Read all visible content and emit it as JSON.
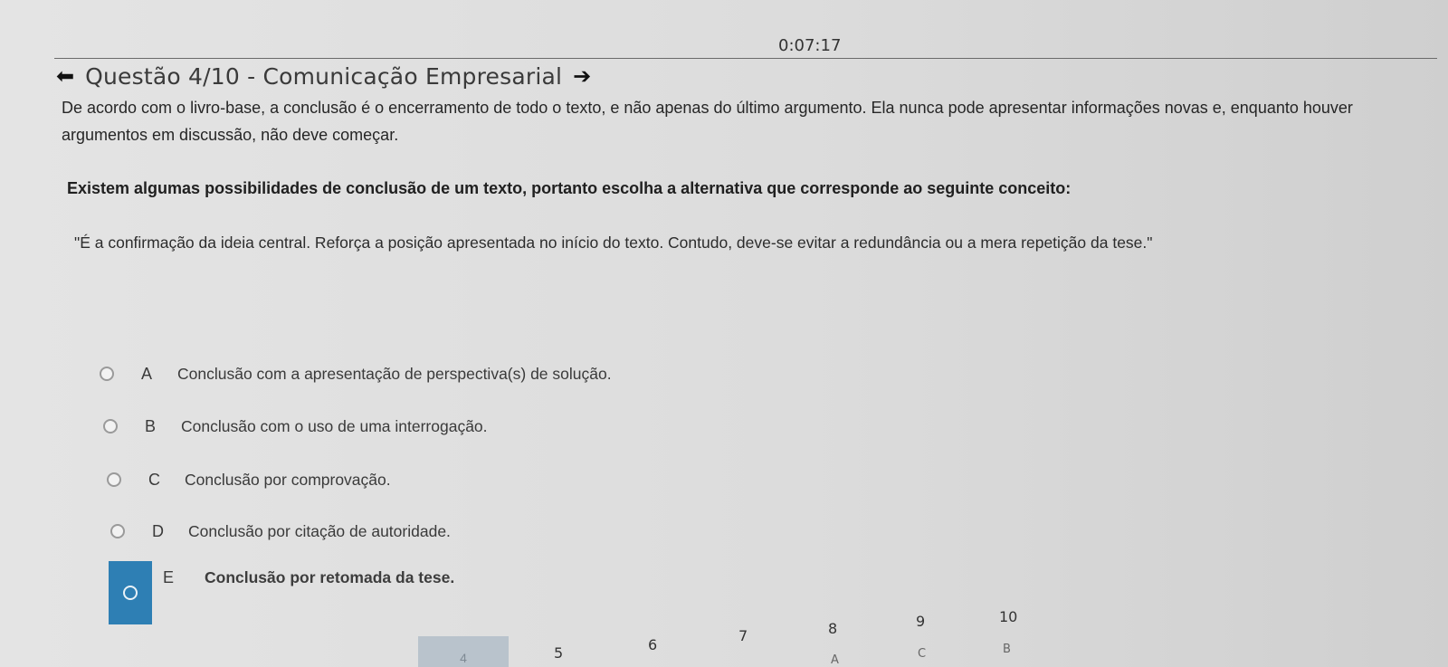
{
  "timer": "0:07:17",
  "header": {
    "title": "Questão 4/10 - Comunicação Empresarial",
    "prev_icon": "arrow-left-icon",
    "next_icon": "arrow-right-icon"
  },
  "statement": "De acordo com o livro-base, a conclusão é o encerramento de todo o texto, e não apenas do último argumento. Ela nunca pode apresentar informações novas e, enquanto houver argumentos em discussão, não deve começar.",
  "question": "Existem algumas possibilidades de conclusão de um texto, portanto escolha a alternativa que corresponde ao seguinte conceito:",
  "quote": "\"É a confirmação da ideia central. Reforça a posição apresentada no início do texto. Contudo, deve-se evitar a redundância ou a mera repetição da tese.\"",
  "options": [
    {
      "letter": "A",
      "text": "Conclusão com a apresentação de perspectiva(s) de solução."
    },
    {
      "letter": "B",
      "text": "Conclusão com o uso de uma interrogação."
    },
    {
      "letter": "C",
      "text": "Conclusão por comprovação."
    },
    {
      "letter": "D",
      "text": "Conclusão por citação de autoridade."
    },
    {
      "letter": "E",
      "text": "Conclusão por retomada da tese."
    }
  ],
  "selected_option": "E",
  "accent_color": "#2e7fb4",
  "navigation": {
    "numbers": [
      "4",
      "5",
      "6",
      "7",
      "8",
      "9",
      "10"
    ],
    "answers": [
      "A",
      "C",
      "B"
    ]
  }
}
